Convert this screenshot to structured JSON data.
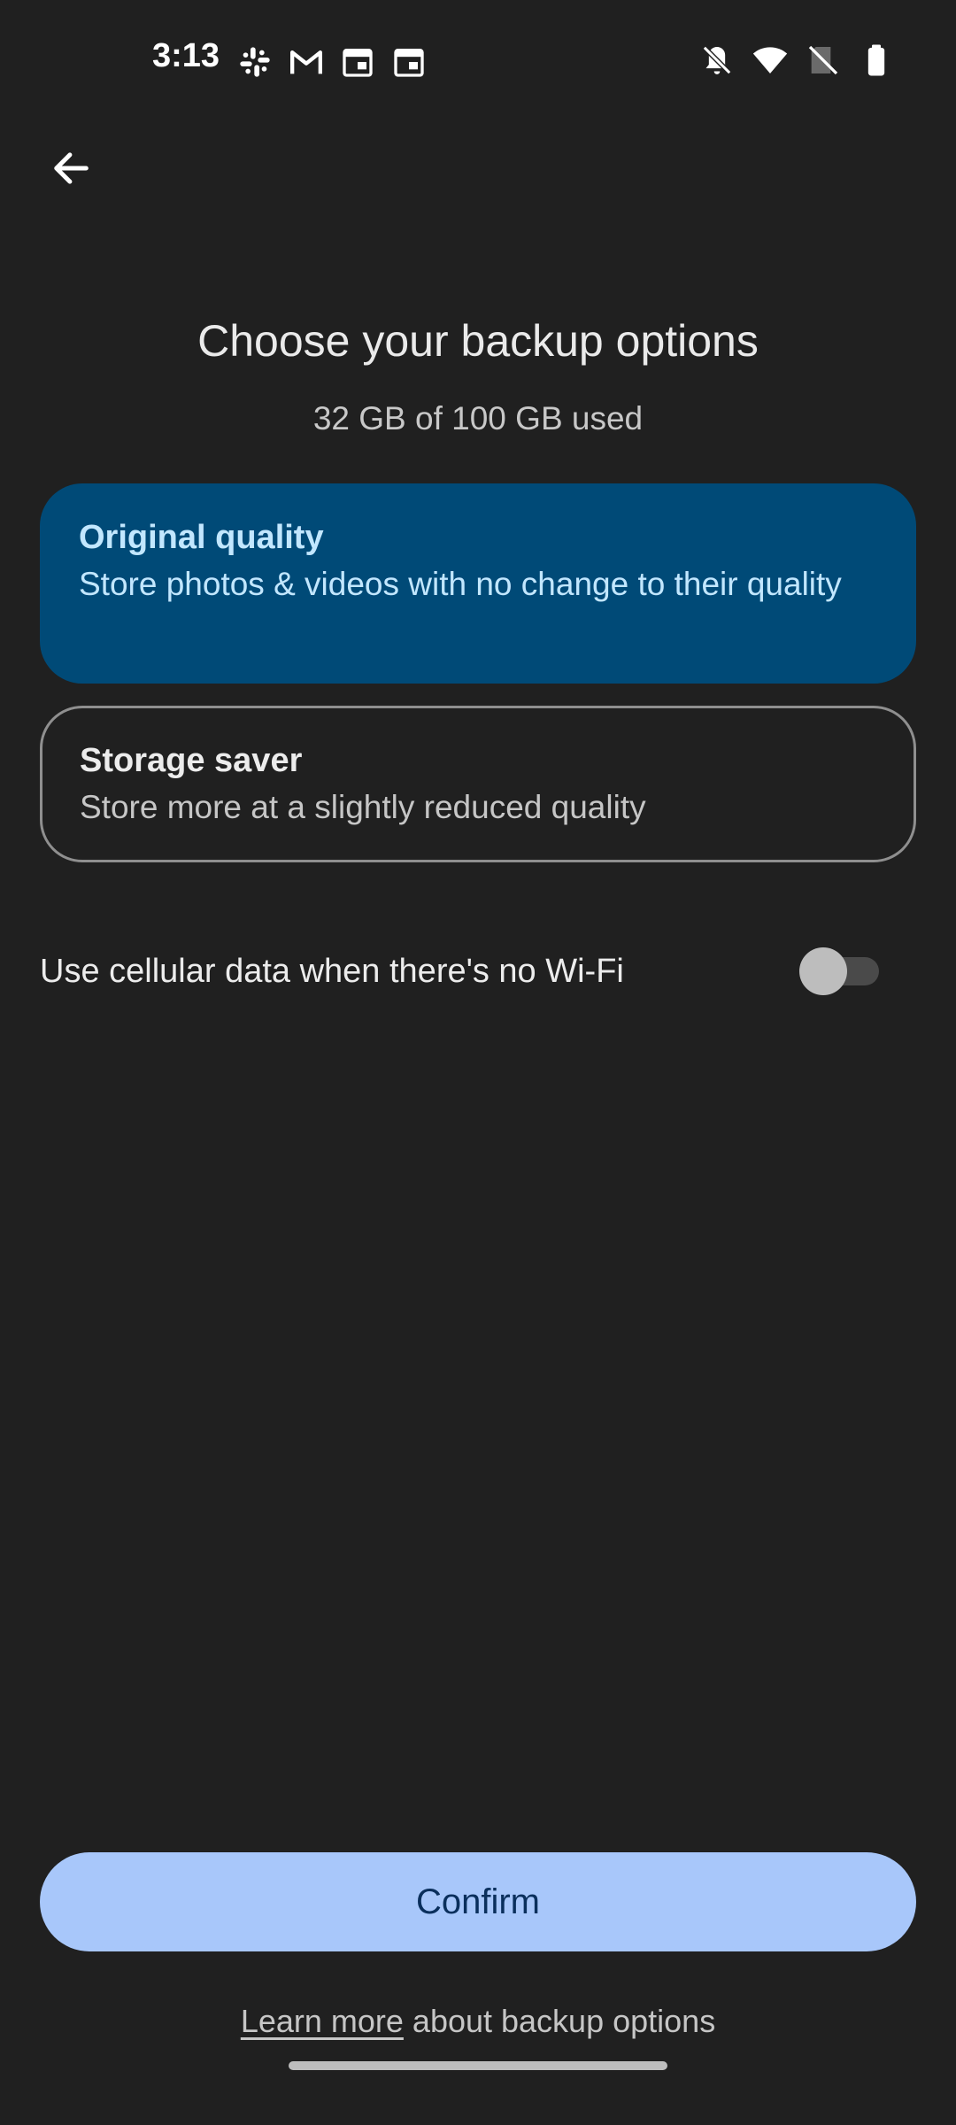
{
  "status_bar": {
    "time": "3:13",
    "notification_icons": [
      "slack-icon",
      "gmail-icon",
      "calendar-icon",
      "calendar-icon"
    ],
    "system_icons": [
      "bell-off-icon",
      "wifi-icon",
      "no-signal-icon",
      "battery-icon"
    ]
  },
  "header": {
    "back_icon": "arrow-left-icon",
    "title": "Choose your backup options",
    "subtitle": "32 GB of 100 GB used"
  },
  "options": [
    {
      "title": "Original quality",
      "description": "Store photos & videos with no change to their quality",
      "selected": true
    },
    {
      "title": "Storage saver",
      "description": "Store more at a slightly reduced quality",
      "selected": false
    }
  ],
  "cellular": {
    "label": "Use cellular data when there's no Wi-Fi",
    "enabled": false
  },
  "confirm_label": "Confirm",
  "footer": {
    "link_text": "Learn more",
    "rest_text": " about backup options"
  },
  "colors": {
    "background": "#202020",
    "selected_card": "#004a77",
    "selected_text": "#c2e7ff",
    "confirm_button": "#a8c7fa",
    "confirm_text": "#0a2f5c"
  }
}
